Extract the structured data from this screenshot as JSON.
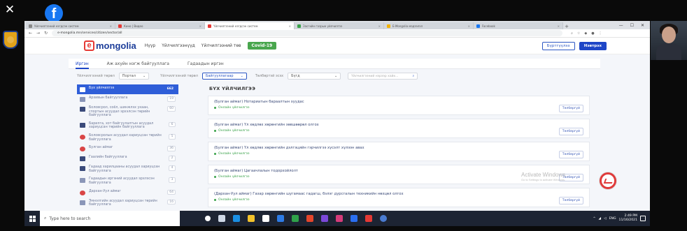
{
  "browser": {
    "tabs": [
      {
        "label": "Уйлчилгээний нэгдсэн систем",
        "active": false
      },
      {
        "label": "Кино | Видео",
        "active": false
      },
      {
        "label": "Үйлчилгээний нэгдсэн систем",
        "active": true
      },
      {
        "label": "Засгийн газрын үйлчилгээ",
        "active": false
      },
      {
        "label": "E-Mongolia мэдээлэл",
        "active": false
      },
      {
        "label": "Facebook",
        "active": false
      }
    ],
    "new_tab": "+",
    "url": "e-mongolia.mn/services/citizen/sector/all",
    "window_controls": [
      "—",
      "☐",
      "✕"
    ]
  },
  "site": {
    "logo_letter": "e",
    "logo_text": "mongolia",
    "nav": [
      "Нүүр",
      "Үйлчилгээнүүд",
      "Үйлчилгээний төв"
    ],
    "covid_label": "Covid-19",
    "register_label": "Бүртгүүлэх",
    "login_label": "Нэвтрэх"
  },
  "tabs": [
    "Иргэн",
    "Аж ахуйн нэгж байгууллага",
    "Гадаадын иргэн"
  ],
  "filters": {
    "type_label": "Үйлчилгээний төрөл",
    "type_value": "Портал",
    "service_label": "Үйлчилгээний төрөл",
    "service_value": "Байгууллагаар",
    "payment_label": "Төлбөртэй эсэх",
    "payment_value": "Бүгд",
    "search_placeholder": "Үйлчилгээний нэрээр хайх..."
  },
  "sidebar": {
    "items": [
      {
        "label": "Бүх үйлчилгээ",
        "count": "662",
        "active": true,
        "icon": "grid-icon"
      },
      {
        "label": "Архивын байгууллага",
        "count": "19",
        "icon": "archive-icon"
      },
      {
        "label": "Боловсрол, соёл, шинжлэх ухаан, спортын асуудал эрхэлсэн төрийн байгууллага",
        "count": "60",
        "icon": "school-icon"
      },
      {
        "label": "Барилга, хот байгуулалтын асуудал хариуцсан төрийн байгууллага",
        "count": "6",
        "icon": "building-icon"
      },
      {
        "label": "Боловсролын асуудал хариуцсан төрийн байгууллага",
        "count": "5",
        "icon": "book-icon"
      },
      {
        "label": "Булган аймаг",
        "count": "36",
        "icon": "emblem-icon"
      },
      {
        "label": "Гаалийн байгууллага",
        "count": "2",
        "icon": "customs-icon"
      },
      {
        "label": "Гадаад харилцааны асуудал хариуцсан байгууллага",
        "count": "4",
        "icon": "globe-icon"
      },
      {
        "label": "Гадаадын иргэний асуудал эрхлэсэн байгууллага",
        "count": "3",
        "icon": "passport-icon"
      },
      {
        "label": "Дархан-Уул аймаг",
        "count": "64",
        "icon": "emblem-icon"
      },
      {
        "label": "Эмнэлгийн асуудал хариуцсан төрийн байгууллага",
        "count": "16",
        "icon": "health-icon"
      }
    ]
  },
  "content": {
    "title": "БҮХ ҮЙЛЧИЛГЭЭ",
    "cards": [
      {
        "title": "(Булган аймаг) Нотариатын бараалтын хуудас",
        "tag": "Онлайн үйлчилгээ",
        "button": "Төлбөргүй"
      },
      {
        "title": "(Булган аймаг) Үл хөдлөх хөрөнгийн зөвшөөрөл олгох",
        "tag": "Онлайн үйлчилгээ",
        "button": "Төлбөргүй"
      },
      {
        "title": "(Булган аймаг) Үл хөдлөх хөрөнгийн дэлгэцийн гэрчилгээ хүсэлт хүлээн авах",
        "tag": "Онлайн үйлчилгээ",
        "button": "Төлбөргүй"
      },
      {
        "title": "(Булган аймаг) Цагаачлалын тодорхойлолт",
        "tag": "Онлайн үйлчилгээ",
        "button": "Төлбөргүй"
      },
      {
        "title": "(Дархан-Уул аймаг) Газар хөрөнгийн шугамаас гадагш, бэлэг дурсгалын техникийн нөхцөл олгох",
        "tag": "Онлайн үйлчилгээ",
        "button": "Төлбөргүй"
      }
    ]
  },
  "overlay": {
    "close": "✕",
    "fb": "f",
    "watermark_title": "Activate Windows",
    "watermark_sub": "Go to Settings to activate Windows."
  },
  "taskbar": {
    "search_placeholder": "Type here to search",
    "time": "2:49 PM",
    "date": "11/16/2021",
    "lang": "ENG"
  }
}
